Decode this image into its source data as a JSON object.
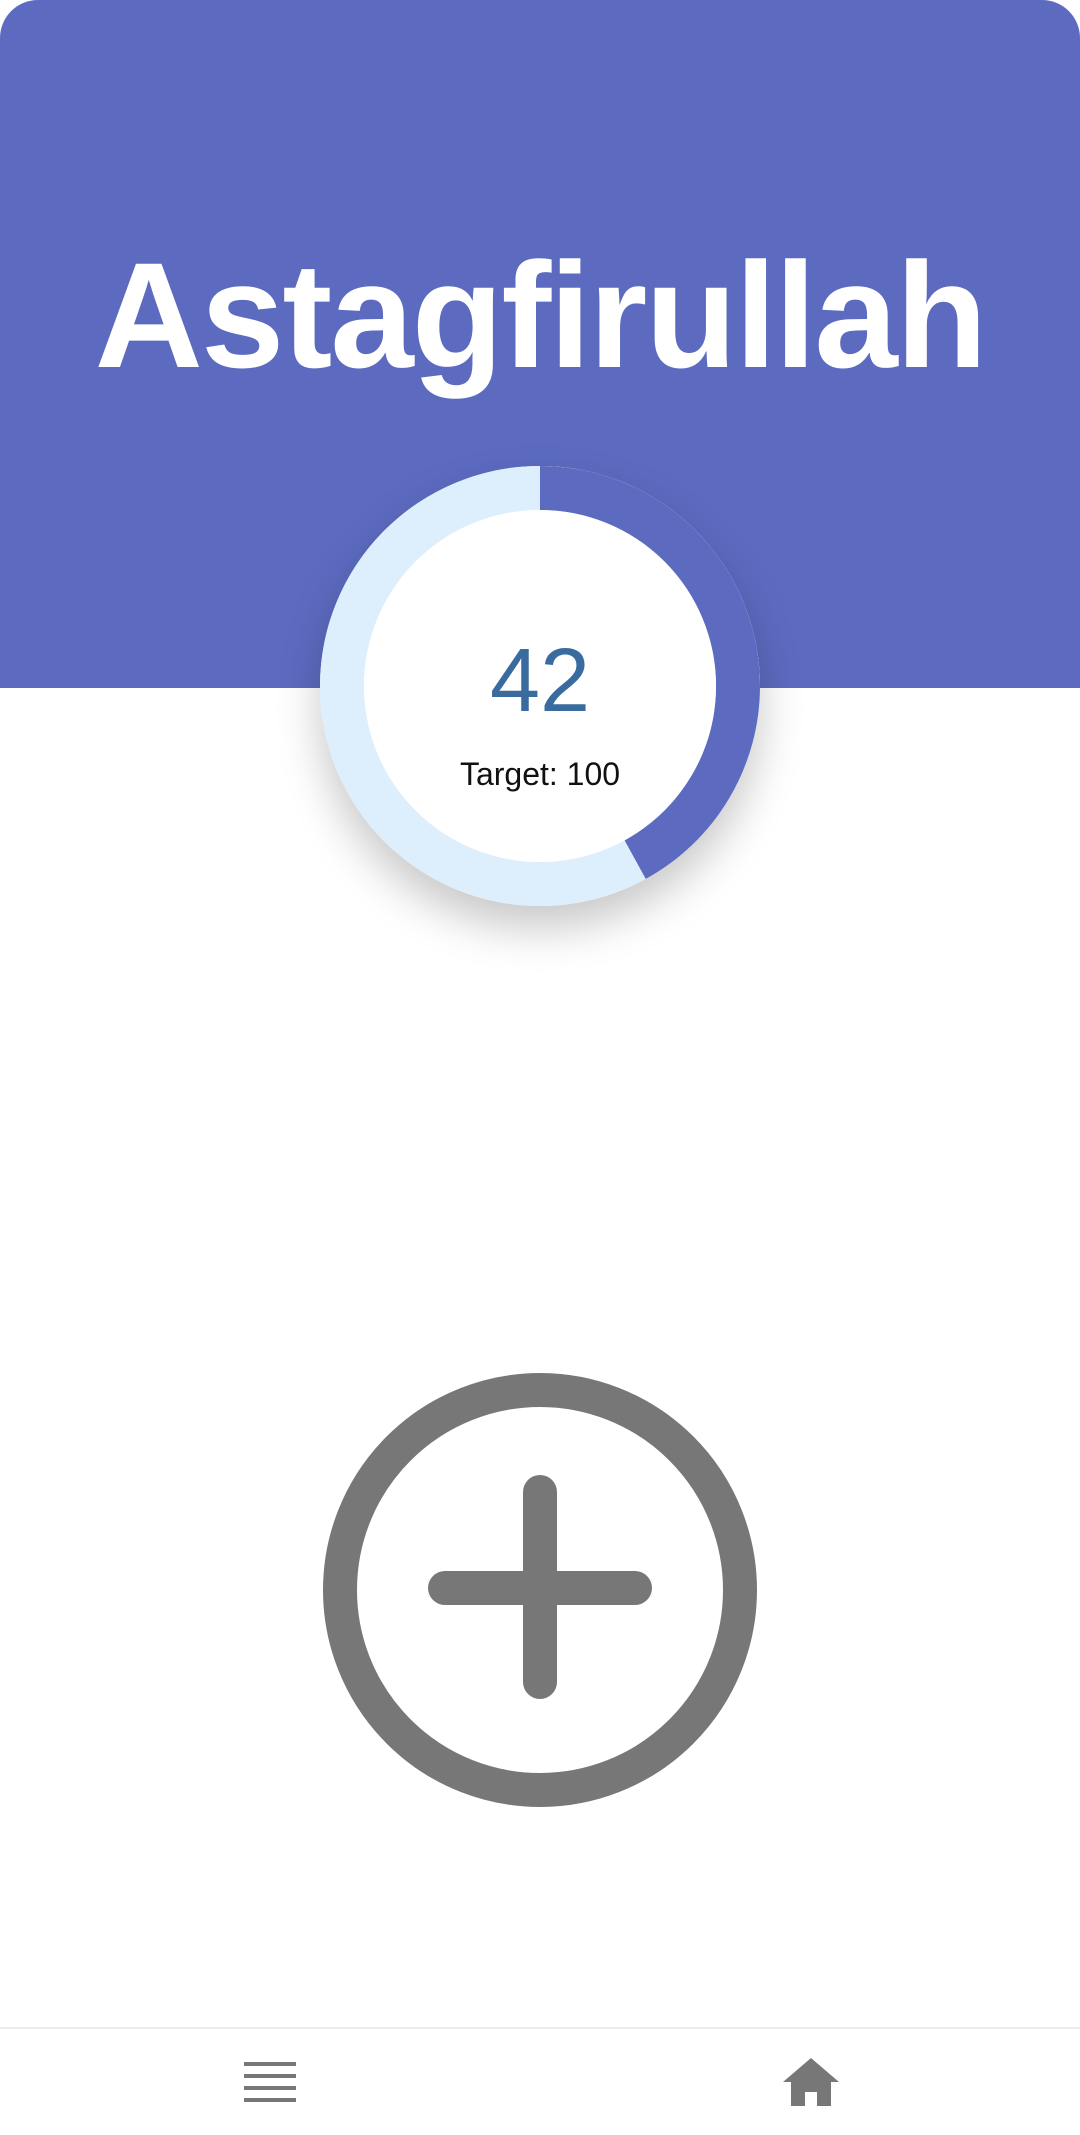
{
  "app": {
    "title": "Astagfirullah"
  },
  "counter": {
    "count": "42",
    "target_label": "Target: 100",
    "progress": 0.42
  },
  "actions": {
    "increment_icon": "plus-circle-icon"
  },
  "bottom_nav": {
    "items": [
      {
        "icon": "menu-icon"
      },
      {
        "icon": "home-icon"
      }
    ]
  },
  "colors": {
    "primary": "#5C6BC0",
    "ring_track": "#DDEEFC",
    "count_text": "#3A6B9E",
    "icon_gray": "#777777",
    "background": "#FFFFFF"
  }
}
